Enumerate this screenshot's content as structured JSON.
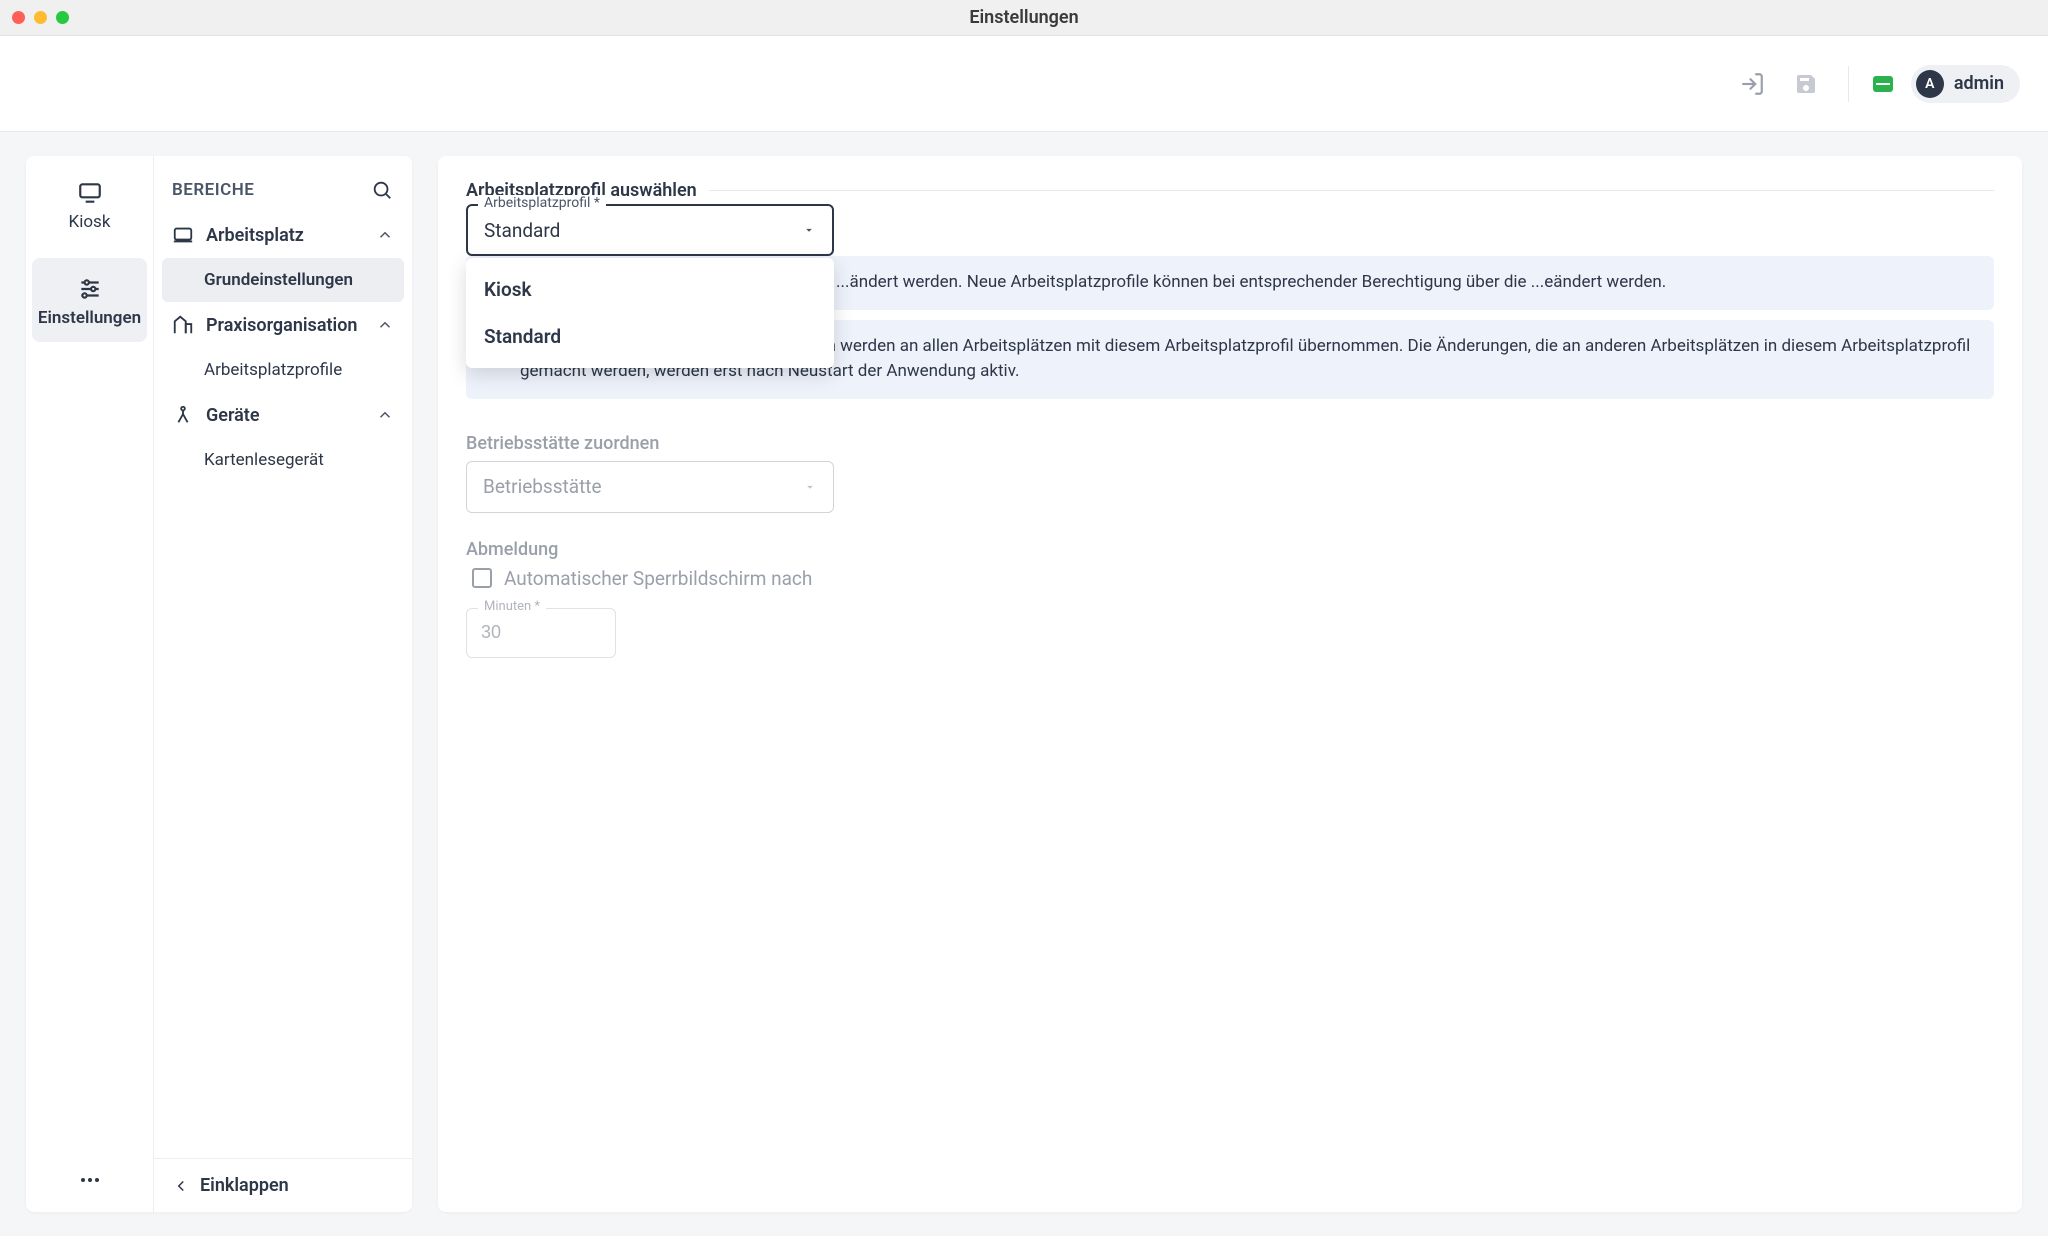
{
  "window": {
    "title": "Einstellungen"
  },
  "topbar": {
    "user": {
      "initial": "A",
      "name": "admin"
    }
  },
  "rail": {
    "items": [
      {
        "label": "Kiosk"
      },
      {
        "label": "Einstellungen"
      }
    ]
  },
  "sidebar": {
    "header": "BEREICHE",
    "groups": [
      {
        "label": "Arbeitsplatz",
        "children": [
          {
            "label": "Grundeinstellungen"
          }
        ]
      },
      {
        "label": "Praxisorganisation",
        "children": [
          {
            "label": "Arbeitsplatzprofile"
          }
        ]
      },
      {
        "label": "Geräte",
        "children": [
          {
            "label": "Kartenlesegerät"
          }
        ]
      }
    ],
    "collapse": "Einklappen"
  },
  "content": {
    "section1": {
      "legend": "Arbeitsplatzprofil auswählen",
      "field_label": "Arbeitsplatzprofil *",
      "selected": "Standard",
      "options": [
        "Kiosk",
        "Standard"
      ],
      "info1": "...ändert werden. Neue Arbeitsplatzprofile können bei entsprechender Berechtigung über die ...eändert werden.",
      "info2": "Änderungen der Arbeitsplatzeinstellungen werden an allen Arbeitsplätzen mit diesem Arbeitsplatzprofil übernommen. Die Änderungen, die an anderen Arbeitsplätzen in diesem Arbeitsplatzprofil gemacht werden, werden erst nach Neustart der Anwendung aktiv."
    },
    "section2": {
      "legend": "Betriebsstätte zuordnen",
      "placeholder": "Betriebsstätte"
    },
    "section3": {
      "legend": "Abmeldung",
      "checkbox_label": "Automatischer Sperrbildschirm nach",
      "minutes_label": "Minuten *",
      "minutes_value": "30"
    }
  }
}
